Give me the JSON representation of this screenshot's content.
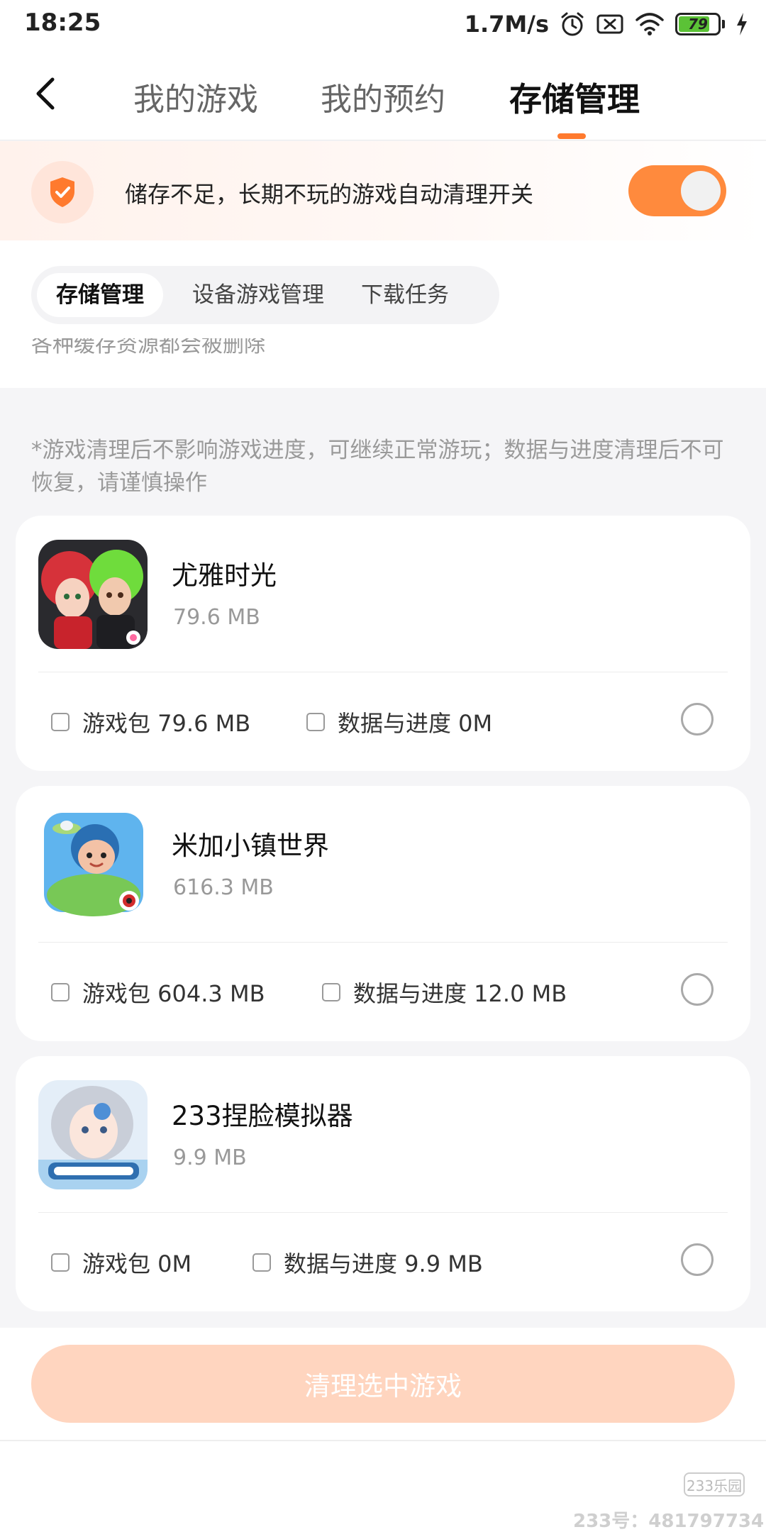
{
  "status_bar": {
    "time": "18:25",
    "network_speed": "1.7M/s",
    "battery_level": "79",
    "icons": [
      "alarm-icon",
      "sim-off-icon",
      "wifi-icon",
      "battery-icon",
      "charging-icon"
    ]
  },
  "nav": {
    "back_icon": "chevron-left-icon",
    "tabs": [
      {
        "label": "我的游戏",
        "active": false
      },
      {
        "label": "我的预约",
        "active": false
      },
      {
        "label": "存储管理",
        "active": true
      }
    ]
  },
  "banner": {
    "icon": "shield-check-icon",
    "text": "储存不足，长期不玩的游戏自动清理开关",
    "toggle_on": true
  },
  "sub_tabs": [
    {
      "label": "存储管理",
      "active": true
    },
    {
      "label": "设备游戏管理",
      "active": false
    },
    {
      "label": "下载任务",
      "active": false
    }
  ],
  "clipped_text": "各种缓存资源都会被删除",
  "notice": "*游戏清理后不影响游戏进度，可继续正常游玩；数据与进度清理后不可恢复，请谨慎操作",
  "games": [
    {
      "name": "尤雅时光",
      "size": "79.6 MB",
      "package_label": "游戏包 79.6 MB",
      "data_label": "数据与进度 0M",
      "icon": "game-icon-youya"
    },
    {
      "name": "米加小镇世界",
      "size": "616.3 MB",
      "package_label": "游戏包 604.3 MB",
      "data_label": "数据与进度 12.0 MB",
      "icon": "game-icon-miga"
    },
    {
      "name": "233捏脸模拟器",
      "size": "9.9 MB",
      "package_label": "游戏包 0M",
      "data_label": "数据与进度 9.9 MB",
      "icon": "game-icon-nielian"
    }
  ],
  "clean_button": "清理选中游戏",
  "watermark": {
    "badge": "233乐园",
    "text": "233号：481797734"
  },
  "colors": {
    "accent": "#ff7a2e",
    "toggle": "#ff8a3d",
    "button_disabled": "#ffd5bf",
    "background": "#f5f5f7"
  }
}
